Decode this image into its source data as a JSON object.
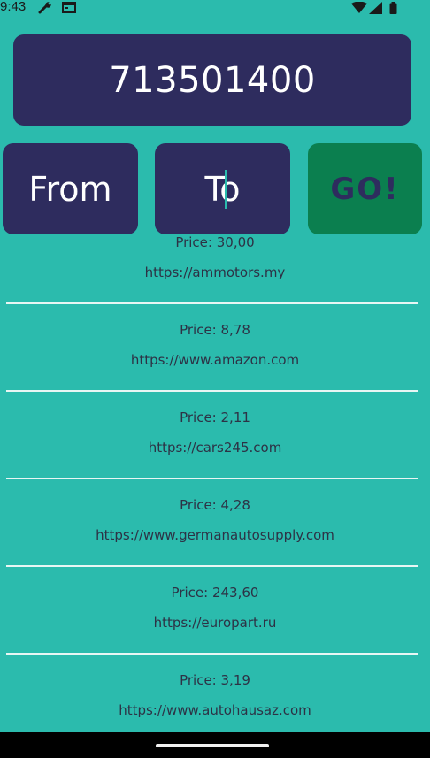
{
  "status_bar": {
    "time": "9:43",
    "icons": [
      "wrench-icon",
      "calendar-icon",
      "wifi-icon",
      "signal-icon",
      "battery-icon"
    ]
  },
  "search": {
    "query": "713501400"
  },
  "buttons": {
    "from_label": "From",
    "to_label": "To",
    "go_label": "GO!"
  },
  "colors": {
    "background": "#2bbbad",
    "panel": "#2e2c5e",
    "go_button": "#0b7f4f"
  },
  "results": [
    {
      "price": "Price: 30,00",
      "url": "https://ammotors.my"
    },
    {
      "price": "Price: 8,78",
      "url": "https://www.amazon.com"
    },
    {
      "price": "Price: 2,11",
      "url": "https://cars245.com"
    },
    {
      "price": "Price: 4,28",
      "url": "https://www.germanautosupply.com"
    },
    {
      "price": "Price: 243,60",
      "url": "https://europart.ru"
    },
    {
      "price": "Price: 3,19",
      "url": "https://www.autohausaz.com"
    }
  ]
}
